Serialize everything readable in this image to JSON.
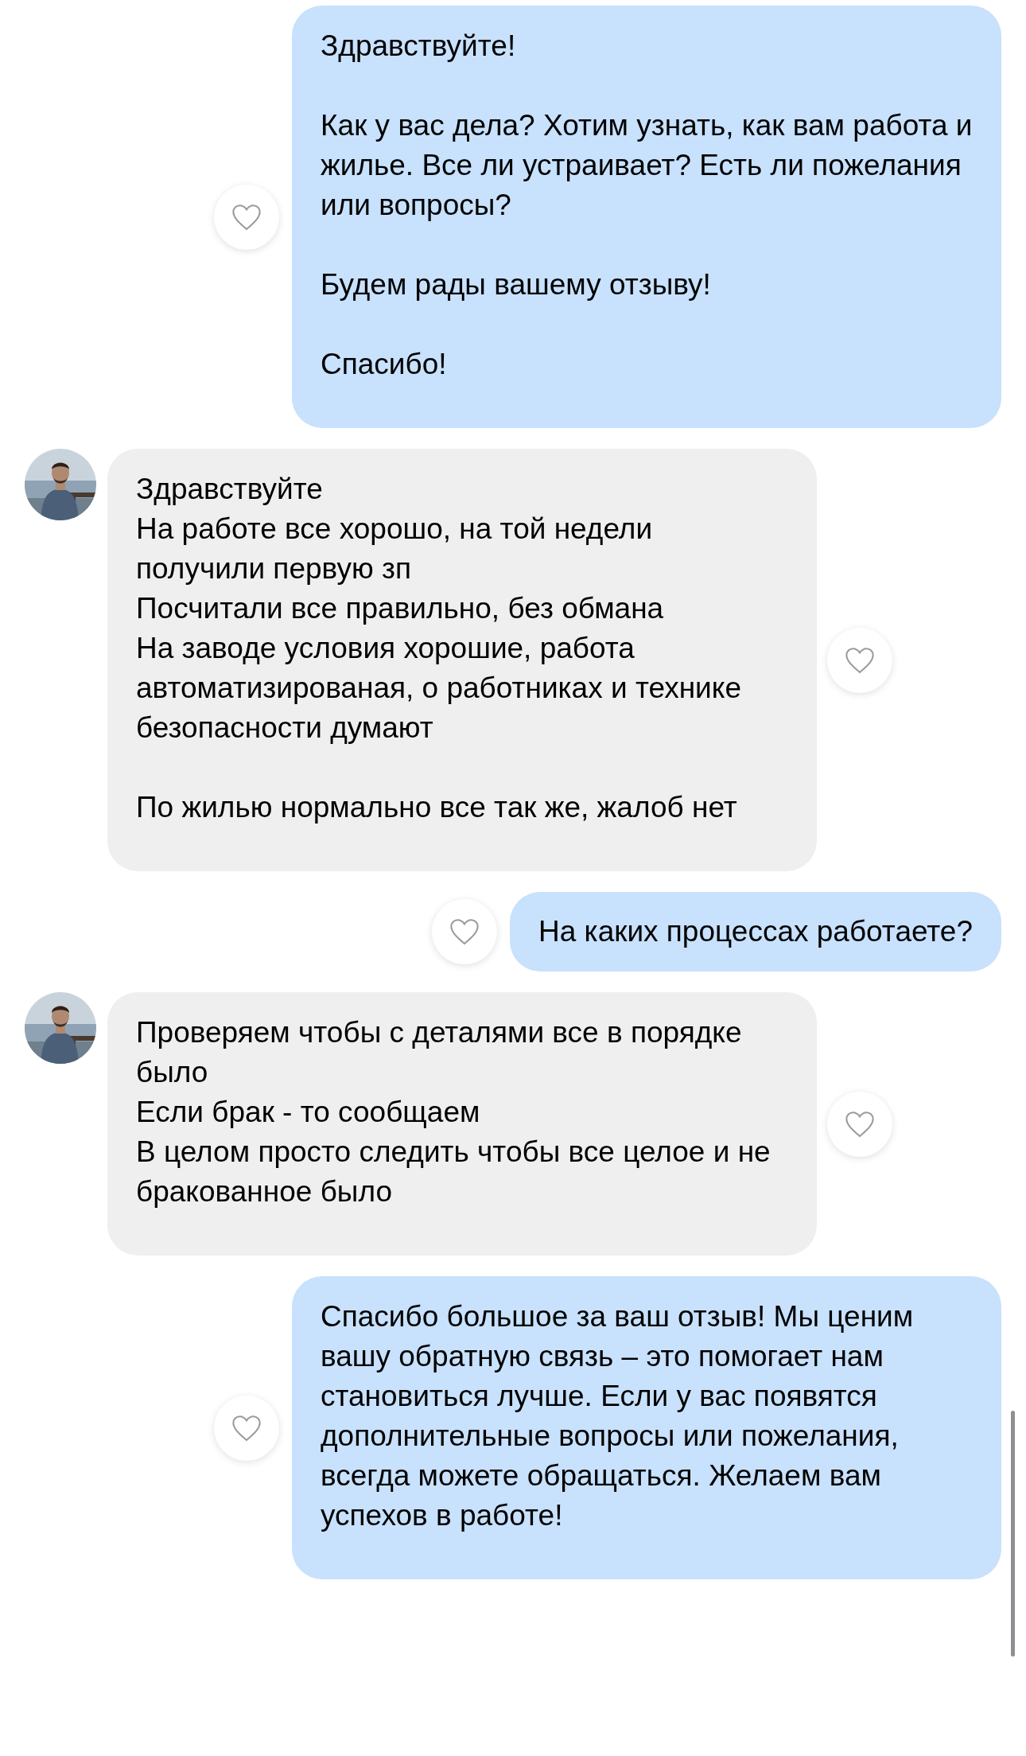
{
  "messages": [
    {
      "kind": "outgoing",
      "text": "Здравствуйте!\n\nКак у вас дела? Хотим узнать, как вам работа и жилье. Все ли устраивает? Есть ли пожелания или вопросы?\n\nБудем рады вашему отзыву!\n\nСпасибо!",
      "liked": false
    },
    {
      "kind": "incoming",
      "text": "Здравствуйте\nНа работе все хорошо, на той недели получили первую зп\nПосчитали все правильно, без обмана\nНа заводе условия хорошие, работа автоматизированая, о работниках и технике безопасности думают\n\nПо жилью нормально все так же, жалоб нет",
      "liked": false
    },
    {
      "kind": "outgoing",
      "text": "На каких процессах работаете?",
      "liked": false
    },
    {
      "kind": "incoming",
      "text": "Проверяем чтобы с деталями все в порядке было\nЕсли брак - то сообщаем\nВ целом просто следить чтобы все целое и не бракованное было",
      "liked": false
    },
    {
      "kind": "outgoing",
      "text": "Спасибо большое за ваш отзыв! Мы ценим вашу обратную связь – это помогает нам становиться лучше. Если у вас появятся дополнительные вопросы или пожелания, всегда можете обращаться. Желаем вам успехов в работе!",
      "liked": false
    }
  ]
}
